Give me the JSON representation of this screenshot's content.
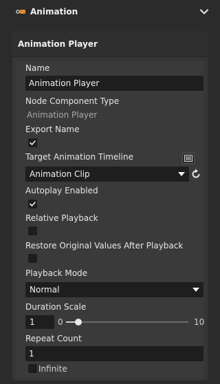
{
  "section": {
    "title": "Animation"
  },
  "panel": {
    "title": "Animation Player",
    "name_label": "Name",
    "name_value": "Animation Player",
    "node_type_label": "Node Component Type",
    "node_type_value": "Animation Player",
    "export_name_label": "Export Name",
    "export_name_checked": true,
    "target_timeline_label": "Target Animation Timeline",
    "target_timeline_value": "Animation Clip",
    "autoplay_label": "Autoplay Enabled",
    "autoplay_checked": true,
    "relative_playback_label": "Relative Playback",
    "relative_playback_checked": false,
    "restore_label": "Restore Original Values After Playback",
    "restore_checked": false,
    "playback_mode_label": "Playback Mode",
    "playback_mode_value": "Normal",
    "duration_scale_label": "Duration Scale",
    "duration_scale_value": "1",
    "duration_min": "0",
    "duration_max": "10",
    "duration_fraction": 0.1,
    "repeat_count_label": "Repeat Count",
    "repeat_count_value": "1",
    "infinite_label": "Infinite",
    "infinite_checked": false
  },
  "colors": {
    "panel_bg": "#363636",
    "field_bg": "#1e1e1e",
    "text": "#e6e6e6",
    "muted": "#a8a8a8"
  }
}
